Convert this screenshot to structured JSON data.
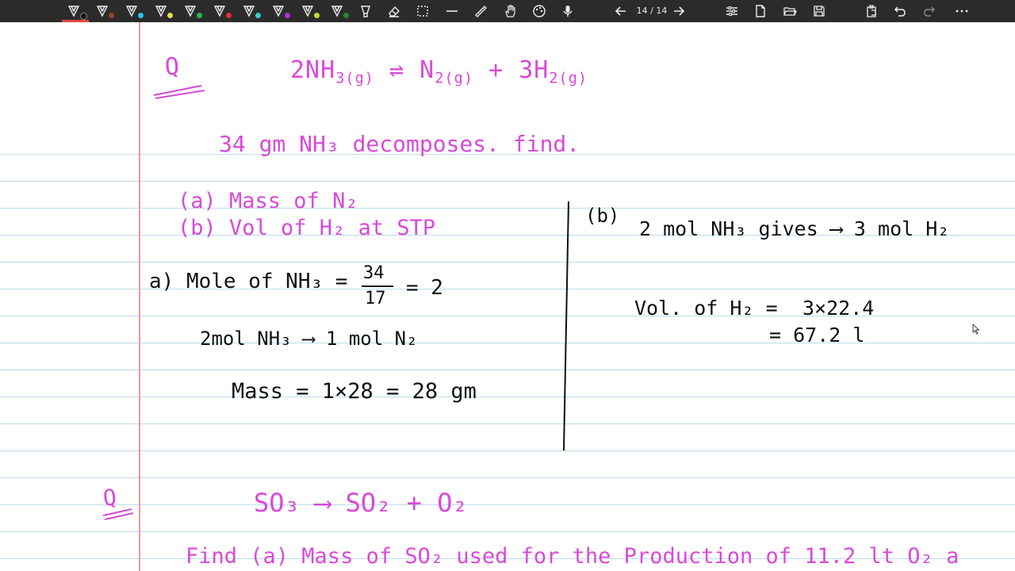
{
  "toolbar": {
    "page_counter": "14 / 14",
    "pen_colors": [
      "#111111",
      "#8b4a2b",
      "#29c4e8",
      "#e8e04a",
      "#28b84a",
      "#2d4be0",
      "#e02d3a",
      "#2bd0d0",
      "#b02de0",
      "#c8d82b",
      "#1f8a2e",
      "#f0a030"
    ],
    "icons": [
      "pen-icon",
      "eraser-icon",
      "lasso-select-icon",
      "line-tool-icon",
      "highlighter-icon",
      "hand-tool-icon",
      "palette-icon",
      "microphone-icon",
      "previous-page-icon",
      "next-page-icon",
      "settings-icon",
      "new-page-icon",
      "open-folder-icon",
      "save-icon",
      "clipboard-icon",
      "undo-icon",
      "redo-icon",
      "more-icon"
    ]
  },
  "notes": {
    "q1_label": "Q",
    "q1_equation": [
      "2NH",
      "3",
      "(g)",
      " ⇌ ",
      "N",
      "2",
      "(g)",
      " + 3H",
      "2",
      "(g)"
    ],
    "q1_statement": "34 gm NH₃ decomposes. find.",
    "q1_part_a": "(a)  Mass of N₂",
    "q1_part_b": "(b)  Vol of H₂  at STP",
    "sol_a_mole": "a)  Mole of NH₃ =",
    "sol_a_frac_num": "34",
    "sol_a_frac_den": "17",
    "sol_a_mole_result": "= 2",
    "sol_a_ratio": "2mol NH₃ ⟶ 1 mol N₂",
    "sol_a_mass": "Mass = 1×28 = 28 gm",
    "sol_b_label": "(b)",
    "sol_b_ratio": "2 mol NH₃ gives ⟶ 3 mol H₂",
    "sol_b_vol": "Vol. of H₂ =",
    "sol_b_vol_calc": "3×22.4",
    "sol_b_vol_result": "= 67.2 l",
    "q2_label": "Q",
    "q2_equation": "SO₃ ⟶ SO₂ + O₂",
    "q2_statement": "Find (a) Mass of SO₂ used for the Production of 11.2 lt O₂ a"
  },
  "colors": {
    "ink_magenta": "#d84ad8",
    "ink_black": "#111111",
    "rule_line": "#bcdcec",
    "margin_line": "#ef9a9a",
    "toolbar_bg": "#2b2b2b"
  }
}
